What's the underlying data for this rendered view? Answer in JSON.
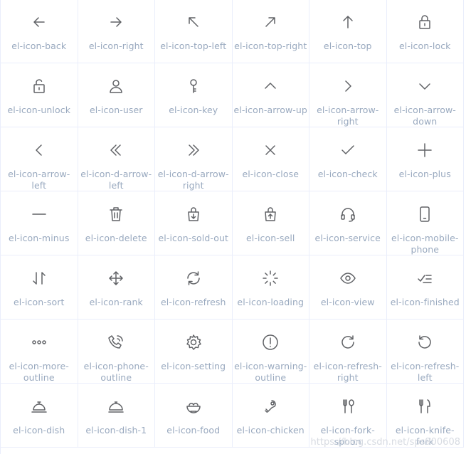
{
  "icons": [
    {
      "name": "el-icon-back",
      "icon": "back-arrow-icon"
    },
    {
      "name": "el-icon-right",
      "icon": "right-arrow-icon"
    },
    {
      "name": "el-icon-top-left",
      "icon": "top-left-arrow-icon"
    },
    {
      "name": "el-icon-top-right",
      "icon": "top-right-arrow-icon"
    },
    {
      "name": "el-icon-top",
      "icon": "top-arrow-icon"
    },
    {
      "name": "el-icon-lock",
      "icon": "lock-icon"
    },
    {
      "name": "el-icon-unlock",
      "icon": "unlock-icon"
    },
    {
      "name": "el-icon-user",
      "icon": "user-icon"
    },
    {
      "name": "el-icon-key",
      "icon": "key-icon"
    },
    {
      "name": "el-icon-arrow-up",
      "icon": "chevron-up-icon"
    },
    {
      "name": "el-icon-arrow-right",
      "icon": "chevron-right-icon"
    },
    {
      "name": "el-icon-arrow-down",
      "icon": "chevron-down-icon"
    },
    {
      "name": "el-icon-arrow-left",
      "icon": "chevron-left-icon"
    },
    {
      "name": "el-icon-d-arrow-left",
      "icon": "double-chevron-left-icon"
    },
    {
      "name": "el-icon-d-arrow-right",
      "icon": "double-chevron-right-icon"
    },
    {
      "name": "el-icon-close",
      "icon": "close-icon"
    },
    {
      "name": "el-icon-check",
      "icon": "check-icon"
    },
    {
      "name": "el-icon-plus",
      "icon": "plus-icon"
    },
    {
      "name": "el-icon-minus",
      "icon": "minus-icon"
    },
    {
      "name": "el-icon-delete",
      "icon": "trash-icon"
    },
    {
      "name": "el-icon-sold-out",
      "icon": "sold-out-bag-icon"
    },
    {
      "name": "el-icon-sell",
      "icon": "sell-bag-icon"
    },
    {
      "name": "el-icon-service",
      "icon": "headset-icon"
    },
    {
      "name": "el-icon-mobile-phone",
      "icon": "mobile-phone-icon"
    },
    {
      "name": "el-icon-sort",
      "icon": "sort-icon"
    },
    {
      "name": "el-icon-rank",
      "icon": "move-icon"
    },
    {
      "name": "el-icon-refresh",
      "icon": "refresh-icon"
    },
    {
      "name": "el-icon-loading",
      "icon": "loading-spinner-icon"
    },
    {
      "name": "el-icon-view",
      "icon": "eye-icon"
    },
    {
      "name": "el-icon-finished",
      "icon": "finished-list-icon"
    },
    {
      "name": "el-icon-more-outline",
      "icon": "more-dots-icon"
    },
    {
      "name": "el-icon-phone-outline",
      "icon": "phone-icon"
    },
    {
      "name": "el-icon-setting",
      "icon": "gear-icon"
    },
    {
      "name": "el-icon-warning-outline",
      "icon": "warning-icon"
    },
    {
      "name": "el-icon-refresh-right",
      "icon": "refresh-right-icon"
    },
    {
      "name": "el-icon-refresh-left",
      "icon": "refresh-left-icon"
    },
    {
      "name": "el-icon-dish",
      "icon": "dish-cloche-icon"
    },
    {
      "name": "el-icon-dish-1",
      "icon": "dish-cloche-1-icon"
    },
    {
      "name": "el-icon-food",
      "icon": "food-bowl-icon"
    },
    {
      "name": "el-icon-chicken",
      "icon": "chicken-leg-icon"
    },
    {
      "name": "el-icon-fork-spoon",
      "icon": "fork-spoon-icon"
    },
    {
      "name": "el-icon-knife-fork",
      "icon": "knife-fork-icon"
    }
  ],
  "watermark": "https://blog.csdn.net/sps900608",
  "colors": {
    "icon": "#606266",
    "label": "#99a9bf",
    "border": "#eaeefb"
  }
}
